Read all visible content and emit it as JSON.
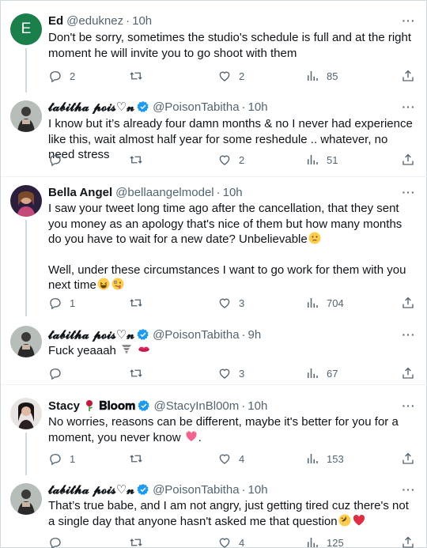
{
  "tweets": [
    {
      "name": "Ed",
      "handle": "@eduknez",
      "dot": "·",
      "time": "10h",
      "avatar_letter": "E",
      "verified": false,
      "paragraphs": [
        "Don't be sorry, sometimes the studio's schedule is full and at the right moment he will invite you to go shoot with them"
      ],
      "replies": "2",
      "retweets": "",
      "likes": "2",
      "views": "85"
    },
    {
      "name": "𝓽𝓪𝓫𝓲𝓽𝓱𝓪 𝓹𝓸𝓲𝓼♡𝓷",
      "handle": "@PoisonTabitha",
      "dot": "·",
      "time": "10h",
      "verified": true,
      "paragraphs": [
        "I know but it’s already four damn months & no I never had experience like this, wait almost half year for some reshedule .. whatever, no need stress"
      ],
      "replies": "",
      "retweets": "",
      "likes": "2",
      "views": "51"
    },
    {
      "name": "Bella Angel",
      "handle": "@bellaangelmodel",
      "dot": "·",
      "time": "10h",
      "verified": false,
      "paragraphs": [
        "I saw your tweet long time ago after the cancellation, that they sent you money as an apology that's nice of them but how many months do you have to wait for a new date? Unbelievable",
        "Well, under these circumstances I want to go work for them with you next time"
      ],
      "replies": "1",
      "retweets": "",
      "likes": "3",
      "views": "704"
    },
    {
      "name": "𝓽𝓪𝓫𝓲𝓽𝓱𝓪 𝓹𝓸𝓲𝓼♡𝓷",
      "handle": "@PoisonTabitha",
      "dot": "·",
      "time": "9h",
      "verified": true,
      "paragraphs": [
        "Fuck yeaaah"
      ],
      "replies": "",
      "retweets": "",
      "likes": "3",
      "views": "67"
    },
    {
      "name_part1": "Stacy",
      "name_part2": "𝐁𝐥𝐨𝐨𝐦",
      "handle": "@StacyInBl00m",
      "dot": "·",
      "time": "10h",
      "verified": true,
      "paragraphs": [
        "No worries, reasons can be different, maybe it's better for you for a moment, you never know",
        "."
      ],
      "replies": "1",
      "retweets": "",
      "likes": "4",
      "views": "153"
    },
    {
      "name": "𝓽𝓪𝓫𝓲𝓽𝓱𝓪 𝓹𝓸𝓲𝓼♡𝓷",
      "handle": "@PoisonTabitha",
      "dot": "·",
      "time": "10h",
      "verified": true,
      "paragraphs": [
        "That’s true babe, and I am not angry, just getting tired cuz there's not a single day that anyone hasn't asked me that question"
      ],
      "replies": "",
      "retweets": "",
      "likes": "4",
      "views": "125"
    }
  ],
  "icons": {
    "reply": "reply-icon",
    "retweet": "retweet-icon",
    "like": "heart-icon",
    "views": "views-icon",
    "share": "share-icon",
    "more": "more-icon",
    "verified": "verified-badge-icon"
  },
  "more_label": "···",
  "colors": {
    "text": "#0f1419",
    "secondary": "#536471",
    "verified": "#1d9bf0",
    "ed_avatar": "#1a7f4b"
  }
}
